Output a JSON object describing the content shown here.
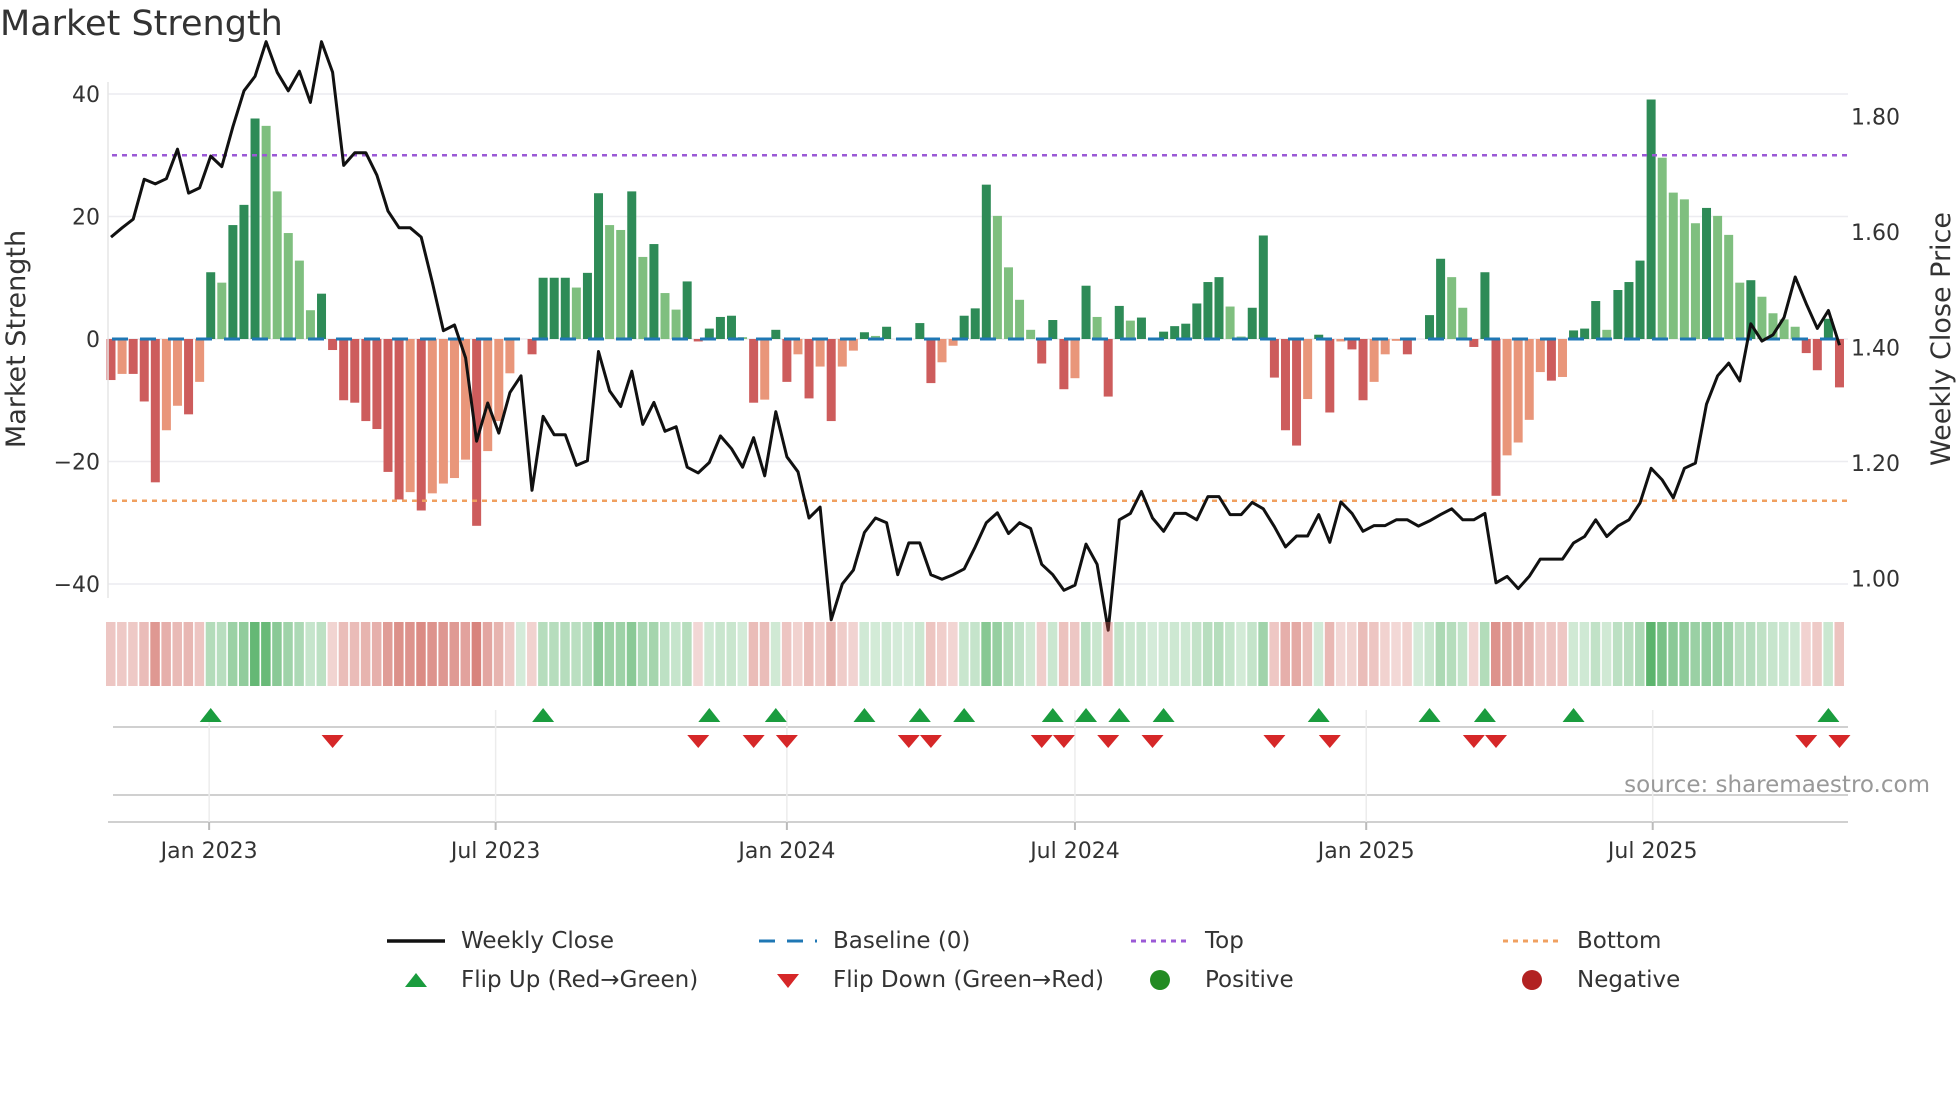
{
  "title": "Market Strength",
  "source": "source: sharemaestro.com",
  "colors": {
    "strong_green": "#2e8b57",
    "weak_green": "#7fbf7f",
    "strong_red": "#cd5c5c",
    "weak_red": "#e9967a",
    "line": "#111111",
    "baseline": "#1f77b4",
    "top": "#9b59d6",
    "bottom": "#f0a060",
    "flip_up": "#1a9c3e",
    "flip_down": "#d62728",
    "positive": "#228b22",
    "negative": "#b22222"
  },
  "chart_data": {
    "type": "bar",
    "title": "Market Strength",
    "ylabel": "Market Strength",
    "y2label": "Weekly Close Price",
    "ylim": [
      -42,
      42
    ],
    "y2lim": [
      0.87,
      1.94
    ],
    "yticks": [
      {
        "v": 40,
        "label": "40"
      },
      {
        "v": 20,
        "label": "20"
      },
      {
        "v": 0,
        "label": "0"
      },
      {
        "v": -20,
        "label": "−20"
      },
      {
        "v": -40,
        "label": "−40"
      }
    ],
    "y2ticks": [
      {
        "v": 1.8,
        "label": "1.80"
      },
      {
        "v": 1.6,
        "label": "1.60"
      },
      {
        "v": 1.4,
        "label": "1.40"
      },
      {
        "v": 1.2,
        "label": "1.20"
      },
      {
        "v": 1.0,
        "label": "1.00"
      }
    ],
    "xticks": [
      {
        "date": "2023-01-01",
        "label": "Jan 2023"
      },
      {
        "date": "2023-07-01",
        "label": "Jul 2023"
      },
      {
        "date": "2024-01-01",
        "label": "Jan 2024"
      },
      {
        "date": "2024-07-01",
        "label": "Jul 2024"
      },
      {
        "date": "2025-01-01",
        "label": "Jan 2025"
      },
      {
        "date": "2025-07-01",
        "label": "Jul 2025"
      }
    ],
    "start_week": "2022-10-31",
    "grid": true,
    "top_level": 30,
    "bottom_level": -26.4,
    "baseline": 0,
    "strength": [
      -6.7,
      -5.7,
      -5.7,
      -10.2,
      -23.4,
      -14.9,
      -10.9,
      -12.3,
      -7.0,
      10.9,
      9.2,
      18.6,
      21.9,
      36,
      34.8,
      24.1,
      17.3,
      12.8,
      4.7,
      7.4,
      -1.8,
      -10,
      -10.4,
      -13.4,
      -14.7,
      -21.7,
      -26.2,
      -25,
      -28,
      -25.2,
      -23.6,
      -22.7,
      -19.7,
      -30.5,
      -18.3,
      -13.4,
      -5.6,
      0,
      -2.5,
      10,
      10,
      10,
      8.4,
      10.8,
      23.8,
      18.6,
      17.8,
      24.1,
      13.4,
      15.5,
      7.5,
      4.8,
      9.4,
      -0.4,
      1.7,
      3.6,
      3.8,
      0.3,
      -10.4,
      -9.9,
      1.5,
      -7,
      -2.5,
      -9.7,
      -4.5,
      -13.4,
      -4.5,
      -1.9,
      1.1,
      0.5,
      2,
      0,
      0,
      2.6,
      -7.2,
      -3.8,
      -1.1,
      3.8,
      5,
      25.2,
      20.1,
      11.7,
      6.4,
      1.5,
      -4,
      3.1,
      -8.2,
      -6.4,
      8.7,
      3.6,
      -9.4,
      5.4,
      3,
      3.5,
      0,
      1.2,
      2.1,
      2.5,
      5.8,
      9.3,
      10.1,
      5.3,
      0.4,
      5.1,
      16.9,
      -6.3,
      -14.9,
      -17.4,
      -9.8,
      0.7,
      -12,
      -0.4,
      -1.7,
      -10,
      -7,
      -2.5,
      -0.3,
      -2.5,
      0,
      3.9,
      13.1,
      10.1,
      5.1,
      -1.3,
      10.9,
      -25.6,
      -19,
      -16.9,
      -13.2,
      -5.4,
      -6.8,
      -6.2,
      1.4,
      1.7,
      6.2,
      1.5,
      8,
      9.3,
      12.8,
      39.1,
      29.6,
      23.9,
      22.8,
      18.9,
      21.4,
      20.1,
      17,
      9.2,
      9.6,
      6.9,
      4.2,
      3.2,
      2,
      -2.3,
      -5.1,
      3.3,
      -7.9
    ],
    "weekly_close": [
      1.591,
      1.607,
      1.622,
      1.691,
      1.683,
      1.692,
      1.743,
      1.667,
      1.676,
      1.731,
      1.713,
      1.782,
      1.844,
      1.869,
      1.929,
      1.876,
      1.844,
      1.878,
      1.824,
      1.929,
      1.876,
      1.715,
      1.737,
      1.737,
      1.698,
      1.636,
      1.607,
      1.607,
      1.591,
      1.513,
      1.429,
      1.439,
      1.382,
      1.238,
      1.304,
      1.252,
      1.322,
      1.351,
      1.153,
      1.281,
      1.249,
      1.249,
      1.196,
      1.204,
      1.393,
      1.325,
      1.298,
      1.359,
      1.267,
      1.305,
      1.255,
      1.263,
      1.193,
      1.183,
      1.201,
      1.247,
      1.225,
      1.193,
      1.244,
      1.178,
      1.289,
      1.211,
      1.185,
      1.105,
      1.124,
      0.929,
      0.991,
      1.015,
      1.08,
      1.105,
      1.097,
      1.007,
      1.062,
      1.062,
      1.007,
      0.999,
      1.007,
      1.017,
      1.055,
      1.097,
      1.114,
      1.078,
      1.097,
      1.087,
      1.025,
      1.007,
      0.98,
      0.989,
      1.06,
      1.025,
      0.911,
      1.102,
      1.113,
      1.151,
      1.105,
      1.082,
      1.113,
      1.113,
      1.102,
      1.142,
      1.142,
      1.111,
      1.111,
      1.132,
      1.121,
      1.09,
      1.055,
      1.074,
      1.074,
      1.111,
      1.063,
      1.133,
      1.113,
      1.082,
      1.092,
      1.092,
      1.102,
      1.102,
      1.091,
      1.1,
      1.111,
      1.121,
      1.102,
      1.102,
      1.113,
      0.993,
      1.004,
      0.983,
      1.004,
      1.034,
      1.034,
      1.034,
      1.062,
      1.073,
      1.102,
      1.073,
      1.091,
      1.102,
      1.131,
      1.191,
      1.171,
      1.14,
      1.191,
      1.2,
      1.302,
      1.351,
      1.373,
      1.342,
      1.441,
      1.411,
      1.422,
      1.452,
      1.522,
      1.476,
      1.433,
      1.464,
      1.404
    ],
    "flip_up_weeks": [
      9,
      39,
      54,
      60,
      68,
      73,
      77,
      85,
      88,
      91,
      95,
      109,
      119,
      124,
      132,
      155
    ],
    "flip_down_weeks": [
      20,
      53,
      58,
      61,
      72,
      74,
      84,
      86,
      90,
      94,
      105,
      110,
      123,
      125,
      153,
      156
    ],
    "legend": [
      {
        "key": "line",
        "label": "Weekly Close"
      },
      {
        "key": "baseline",
        "label": "Baseline (0)"
      },
      {
        "key": "top",
        "label": "Top"
      },
      {
        "key": "bottom",
        "label": "Bottom"
      },
      {
        "key": "flip_up",
        "label": "Flip Up (Red→Green)"
      },
      {
        "key": "flip_down",
        "label": "Flip Down (Green→Red)"
      },
      {
        "key": "positive",
        "label": "Positive"
      },
      {
        "key": "negative",
        "label": "Negative"
      }
    ]
  }
}
